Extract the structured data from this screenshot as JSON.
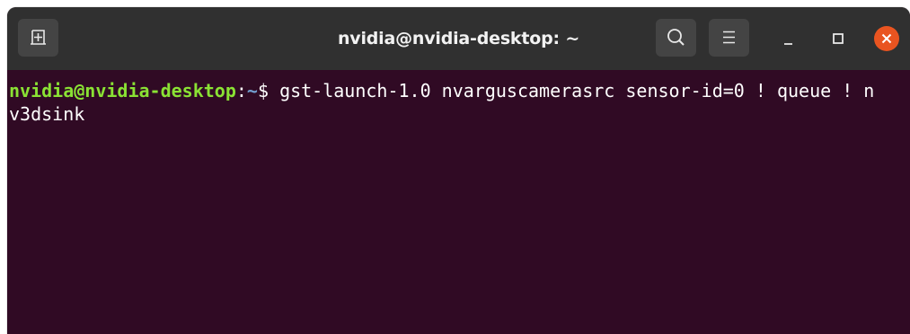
{
  "window": {
    "title": "nvidia@nvidia-desktop: ~"
  },
  "icons": {
    "new_tab": "new-tab-icon",
    "search": "search-icon",
    "menu": "hamburger-menu-icon",
    "minimize": "minimize-icon",
    "maximize": "maximize-icon",
    "close": "close-icon"
  },
  "terminal": {
    "prompt_user": "nvidia@nvidia-desktop",
    "prompt_colon": ":",
    "prompt_path": "~",
    "prompt_symbol": "$ ",
    "command_line1": "gst-launch-1.0 nvarguscameras​rc sensor-id=0 ! queue ! n",
    "command_line2": "v3dsink"
  },
  "colors": {
    "terminal_background": "#300a24",
    "titlebar": "#303030",
    "prompt_user": "#8ae234",
    "prompt_path": "#729fcf",
    "close_button": "#e95420"
  }
}
